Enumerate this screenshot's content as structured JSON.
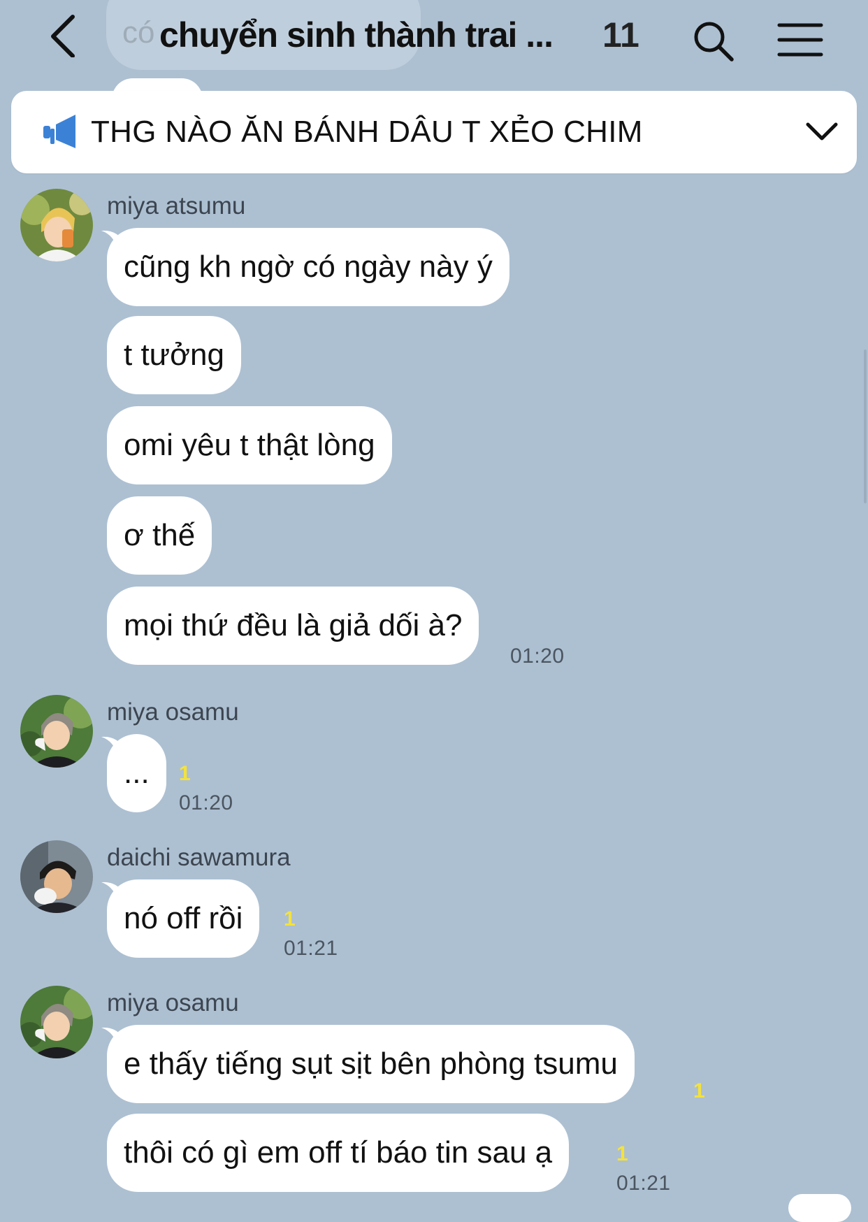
{
  "header": {
    "title": "chuyển sinh thành trai ...",
    "member_count": "11",
    "background_hint": "có"
  },
  "announcement": {
    "text": "THG NÀO ĂN BÁNH DÂU T XẺO CHIM"
  },
  "messages": [
    {
      "sender": "miya atsumu",
      "bubbles": [
        {
          "text": "cũng kh ngờ có ngày này ý"
        },
        {
          "text": "t tưởng"
        },
        {
          "text": "omi yêu t thật lòng"
        },
        {
          "text": "ơ thế"
        },
        {
          "text": "mọi thứ đều là giả dối à?",
          "time": "01:20"
        }
      ]
    },
    {
      "sender": "miya osamu",
      "bubbles": [
        {
          "text": "...",
          "unread": "1",
          "time": "01:20"
        }
      ]
    },
    {
      "sender": "daichi sawamura",
      "bubbles": [
        {
          "text": "nó off rồi",
          "unread": "1",
          "time": "01:21"
        }
      ]
    },
    {
      "sender": "miya osamu",
      "bubbles": [
        {
          "text": "e thấy tiếng sụt sịt bên phòng tsumu",
          "unread": "1"
        },
        {
          "text": "thôi có gì em off tí báo tin sau ạ",
          "unread": "1",
          "time": "01:21"
        }
      ]
    }
  ],
  "colors": {
    "background": "#adc0d2",
    "bubble": "#ffffff",
    "unread": "#f4e23c",
    "announcement_icon": "#3b82d6"
  }
}
